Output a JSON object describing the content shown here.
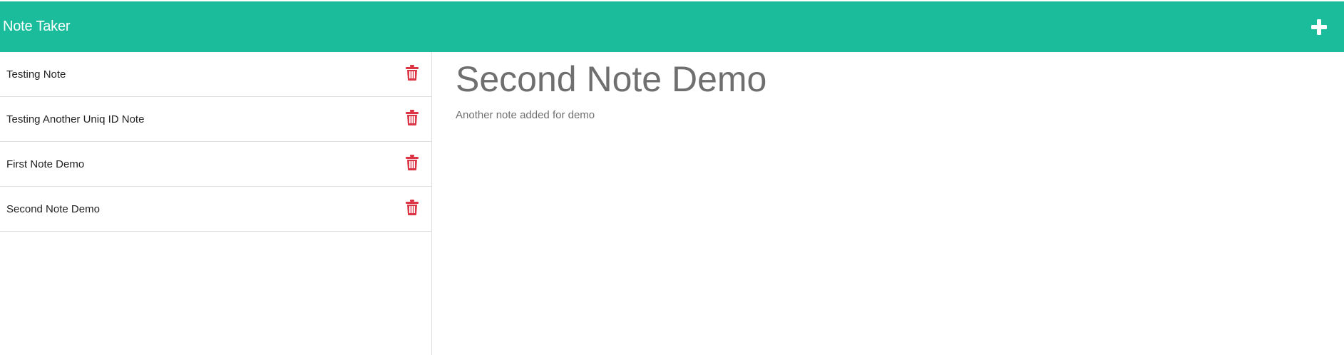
{
  "header": {
    "app_title": "Note Taker",
    "new_note_icon": "plus-icon"
  },
  "colors": {
    "accent": "#1abc9c",
    "delete": "#dc3545",
    "text_muted": "#6f6f6f"
  },
  "sidebar": {
    "notes": [
      {
        "title": "Testing Note",
        "delete_icon": "trash-icon"
      },
      {
        "title": "Testing Another Uniq ID Note",
        "delete_icon": "trash-icon"
      },
      {
        "title": "First Note Demo",
        "delete_icon": "trash-icon"
      },
      {
        "title": "Second Note Demo",
        "delete_icon": "trash-icon"
      }
    ]
  },
  "main": {
    "note_title": "Second Note Demo",
    "note_text": "Another note added for demo"
  }
}
